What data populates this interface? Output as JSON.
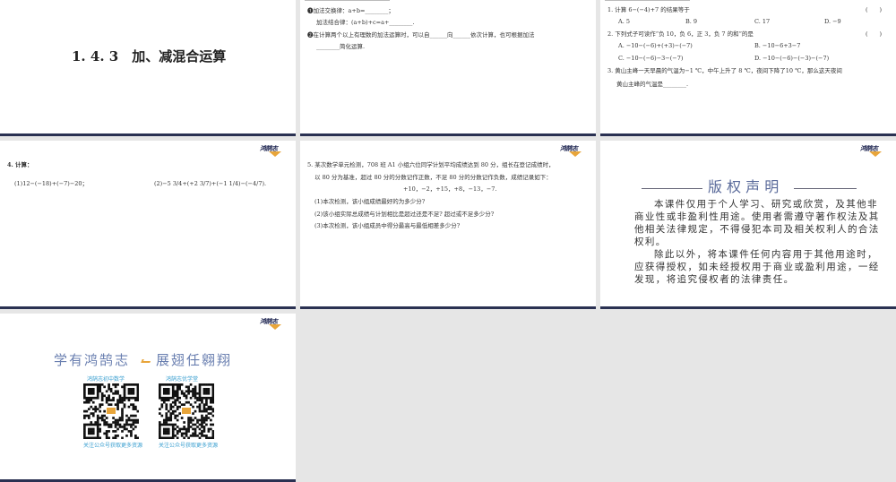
{
  "slides": [
    {
      "title": "1. 4. 3　加、减混合运算"
    },
    {
      "lines": [
        "❶加法交换律：a+b=________；",
        "加法结合律：(a+b)+c=a+________.",
        "❷在计算两个以上有理数的加法运算时，可以自______向______依次计算，也可根据加法",
        "________简化运算."
      ]
    },
    {
      "q1": "1. 计算 6−(−4)+7 的结果等于",
      "paren": "(　　)",
      "q1_opts": [
        "A. 5",
        "B. 9",
        "C. 17",
        "D. −9"
      ],
      "q2": "2. 下列式子可读作“负 10，负 6，正 3，负 7 的和”的是",
      "q2_opts": [
        "A. −10−(−6)+(+3)−(−7)",
        "B. −10−6+3−7",
        "C. −10−(−6)−3−(−7)",
        "D. −10−(−6)−(−3)−(−7)"
      ],
      "q3": [
        "3. 黄山主峰一天早晨的气温为−1 ℃，中午上升了 8 ℃，夜间下降了10 ℃，那么这天夜间",
        "黄山主峰的气温是________."
      ]
    },
    {
      "q4": "4. 计算：",
      "p1": "(1)12−(−18)+(−7)−20；",
      "p2": "(2)−5 3/4+(+2 3/7)+(−1 1/4)−(−4/7)."
    },
    {
      "lines": [
        "5. 某次数学单元检测，708 班 A1 小组六位同学计划平均成绩达到 80 分，组长在登记成绩时，",
        "以 80 分为基准，超过 80 分的分数记作正数，不足 80 分的分数记作负数，成绩记录如下：",
        "+10，−2，+15，+8，−13，−7.",
        "(1)本次检测，该小组成绩最好的为多少分?",
        "(2)该小组实际总成绩与计划相比是超过还是不足? 超过或不足多少分?",
        "(3)本次检测，该小组成员中得分最高与最低相差多少分?"
      ]
    },
    {
      "title": "版 权 声 明",
      "body": [
        "本课件仅用于个人学习、研究或欣赏，及其他非",
        "商业性或非盈利性用途。使用者需遵守著作权法及其",
        "他相关法律规定，不得侵犯本司及相关权利人的合法",
        "权利。",
        "除此以外，将本课件任何内容用于其他用途时，",
        "应获得授权，如未经授权用于商业或盈利用途，一经",
        "发现，将追究侵权者的法律责任。"
      ]
    },
    {
      "slogan_left": "学有鸿鹄志",
      "slogan_right": "展翅任翱翔",
      "qr": [
        {
          "title": "鸿鹄志初中数学",
          "caption": "关注公众号获取更多资源"
        },
        {
          "title": "鸿鹄志优学堂",
          "caption": "关注公众号获取更多资源"
        }
      ]
    }
  ],
  "logo_text": "鸿鹄志",
  "colors": {
    "border": "#2a3152",
    "accent": "#e8a53a",
    "title_blue": "#5a6a9a",
    "qr_label": "#3a9fd0"
  }
}
